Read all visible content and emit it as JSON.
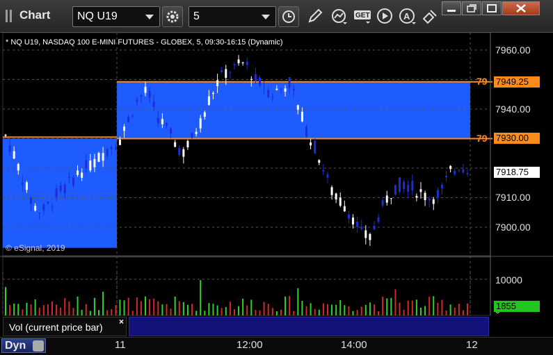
{
  "window": {
    "title": "Chart",
    "minimize_icon": "minimize-icon",
    "restore_icon": "restore-icon",
    "maximize_icon": "maximize-icon",
    "close_icon": "close-icon"
  },
  "toolbar": {
    "symbol": "NQ U19",
    "interval": "5",
    "icons": [
      "settings-gear-icon",
      "clock-icon",
      "pencil-icon",
      "study-icon",
      "get-icon",
      "play-icon",
      "alert-icon",
      "tools-icon"
    ]
  },
  "chart": {
    "info_line": "* NQ U19, NASDAQ 100 E-MINI FUTURES - GLOBEX, 5, 09:30-16:15 (Dynamic)",
    "copyright": "© eSignal, 2019",
    "price_axis": [
      "7960.00",
      "7950.00",
      "7940.00",
      "7930.00",
      "7920.00",
      "7910.00",
      "7900.00"
    ],
    "levels": [
      {
        "tag": "79",
        "label": "7949.25",
        "price": 7949.25,
        "color": "#ff8c1a"
      },
      {
        "tag": "79",
        "label": "7930.00",
        "price": 7930.0,
        "color": "#ff8c1a"
      }
    ],
    "last_price": "7918.75",
    "time_axis": [
      "11",
      "12:00",
      "14:00",
      "12"
    ],
    "colors": {
      "zone": "#1f5cff",
      "up": "#ffffff",
      "down": "#1a2fd6",
      "level": "#ff8c1a",
      "vol_up": "#2fd12a",
      "vol_down": "#d12a2a"
    }
  },
  "volume": {
    "study_label": "Vol (current price bar)",
    "close_glyph": "×",
    "axis": [
      "10000",
      "0"
    ],
    "last": "1855"
  },
  "bottom": {
    "mode_label": "Dyn"
  },
  "chart_data": {
    "type": "candlestick",
    "title": "* NQ U19, NASDAQ 100 E-MINI FUTURES - GLOBEX, 5, 09:30-16:15 (Dynamic)",
    "xlabel": "",
    "ylabel": "",
    "x_ticks": [
      "11",
      "12:00",
      "14:00",
      "12"
    ],
    "y_ticks": [
      7900,
      7910,
      7920,
      7930,
      7940,
      7950,
      7960
    ],
    "ylim": [
      7893,
      7963
    ],
    "grid": true,
    "levels": [
      7930.0,
      7949.25
    ],
    "last_price": 7918.75,
    "volume_last": 1855,
    "volume_ticks": [
      0,
      10000
    ]
  }
}
